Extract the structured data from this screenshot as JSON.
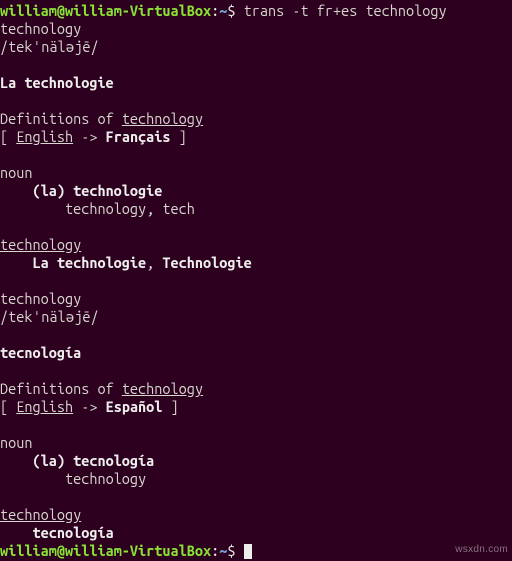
{
  "prompt": {
    "user": "william",
    "host": "william-VirtualBox",
    "cwd_symbol": "~",
    "sep1": "@",
    "sep2": ":",
    "sep3": "$",
    "command": "trans -t fr+es technology"
  },
  "fr": {
    "query": "technology",
    "phonetic": "/tekˈnäləjē/",
    "headline": "La technologie",
    "definitions_label_pre": "Definitions of ",
    "definitions_word": "technology",
    "bracket_open": "[ ",
    "src_lang": "English",
    "arrow": " -> ",
    "dst_lang": "Français",
    "bracket_close": " ]",
    "pos": "noun",
    "entry_indent": "    ",
    "entry": "(la) technologie",
    "rev_indent": "        ",
    "rev": "technology, tech",
    "tail_word": "technology",
    "tail_indent": "    ",
    "tail_trans1": "La technologie",
    "tail_comma": ", ",
    "tail_trans2": "Technologie"
  },
  "es": {
    "query": "technology",
    "phonetic": "/tekˈnäləjē/",
    "headline": "tecnología",
    "definitions_label_pre": "Definitions of ",
    "definitions_word": "technology",
    "bracket_open": "[ ",
    "src_lang": "English",
    "arrow": " -> ",
    "dst_lang": "Español",
    "bracket_close": " ]",
    "pos": "noun",
    "entry_indent": "    ",
    "entry": "(la) tecnología",
    "rev_indent": "        ",
    "rev": "technology",
    "tail_word": "technology",
    "tail_indent": "    ",
    "tail_trans": "tecnología"
  },
  "watermark": "wsxdn.com"
}
